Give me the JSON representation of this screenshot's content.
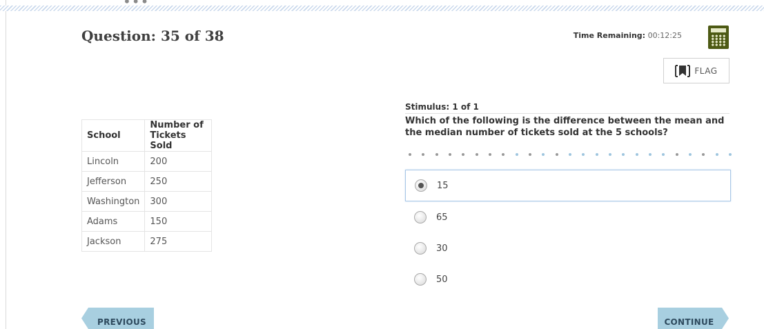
{
  "header": {
    "question_title": "Question: 35 of 38",
    "time_label": "Time Remaining:",
    "time_value": "00:12:25",
    "calculator_icon": "calculator-icon",
    "flag_label": "FLAG",
    "flag_icon": "bookmark-flag-icon"
  },
  "table": {
    "headers": [
      "School",
      "Number of Tickets Sold"
    ],
    "rows": [
      [
        "Lincoln",
        "200"
      ],
      [
        "Jefferson",
        "250"
      ],
      [
        "Washington",
        "300"
      ],
      [
        "Adams",
        "150"
      ],
      [
        "Jackson",
        "275"
      ]
    ]
  },
  "stimulus": {
    "label": "Stimulus: 1 of 1",
    "question": "Which of the following is the difference between the mean and the median number of tickets sold at the 5 schools?"
  },
  "choices": [
    {
      "label": "15",
      "selected": true
    },
    {
      "label": "65",
      "selected": false
    },
    {
      "label": "30",
      "selected": false
    },
    {
      "label": "50",
      "selected": false
    }
  ],
  "nav": {
    "previous_label": "PREVIOUS",
    "continue_label": "CONTINUE"
  },
  "colors": {
    "nav_button": "#a8cfe0",
    "calculator": "#4d5a14",
    "selected_border": "#a7c6e6"
  }
}
